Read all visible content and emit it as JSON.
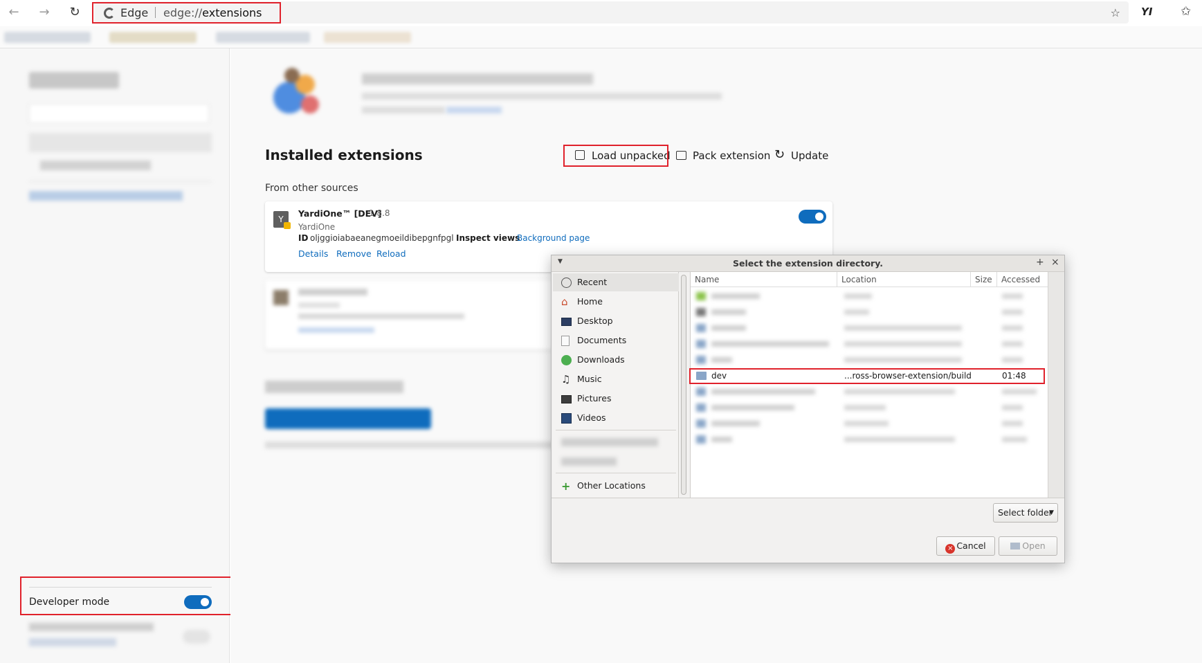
{
  "browser": {
    "brand": "Edge",
    "url_scheme": "edge://",
    "url_path": "extensions",
    "profile_label": "YI"
  },
  "extensions_page": {
    "installed_title": "Installed extensions",
    "actions": {
      "load_unpacked": "Load unpacked",
      "pack_extension": "Pack extension",
      "update": "Update"
    },
    "section_label": "From other sources",
    "extension": {
      "name": "YardiOne™ [DEV]",
      "version": "1.8.8",
      "publisher": "YardiOne",
      "id_label": "ID",
      "id_value": "oljggioiabaeanegmoeildibepgnfpgl",
      "inspect_label": "Inspect views",
      "inspect_link": "Background page",
      "links": {
        "details": "Details",
        "remove": "Remove",
        "reload": "Reload"
      },
      "enabled": true
    },
    "developer_mode": {
      "label": "Developer mode",
      "enabled": true
    }
  },
  "file_dialog": {
    "title": "Select the extension directory.",
    "places": [
      {
        "label": "Recent",
        "icon": "clock-icon"
      },
      {
        "label": "Home",
        "icon": "home-icon"
      },
      {
        "label": "Desktop",
        "icon": "desktop-icon"
      },
      {
        "label": "Documents",
        "icon": "document-icon"
      },
      {
        "label": "Downloads",
        "icon": "download-icon"
      },
      {
        "label": "Music",
        "icon": "music-icon"
      },
      {
        "label": "Pictures",
        "icon": "picture-icon"
      },
      {
        "label": "Videos",
        "icon": "video-icon"
      },
      {
        "label": "Other Locations",
        "icon": "plus-icon"
      }
    ],
    "columns": {
      "name": "Name",
      "location": "Location",
      "size": "Size",
      "accessed": "Accessed"
    },
    "selected_row": {
      "name": "dev",
      "location": "...ross-browser-extension/build",
      "accessed": "01:48"
    },
    "filter_label": "Select folder",
    "cancel_label": "Cancel",
    "open_label": "Open"
  },
  "colors": {
    "accent": "#0f6cbd",
    "highlight": "#e0212b"
  }
}
